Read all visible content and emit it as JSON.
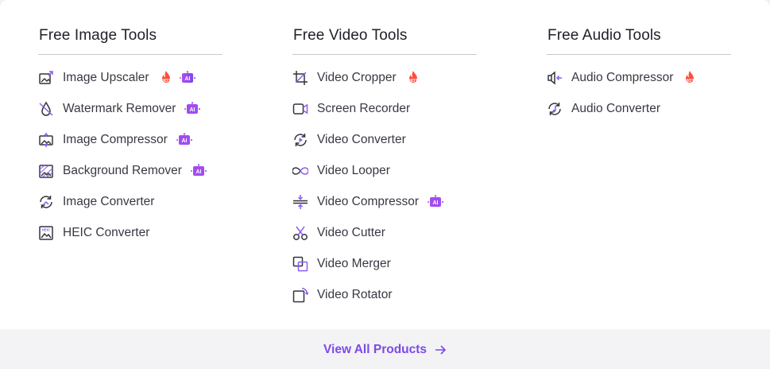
{
  "colors": {
    "accent": "#7d49ea",
    "hot": "#ff4d3a",
    "ai_gradient": [
      "#b14cf2",
      "#7d49ea"
    ],
    "icon_dark": "#34343c",
    "icon_accent": "#8a5cf0"
  },
  "columns": [
    {
      "title": "Free Image Tools",
      "items": [
        {
          "label": "Image Upscaler",
          "icon": "image-upscale-icon",
          "hot": true,
          "ai": true
        },
        {
          "label": "Watermark Remover",
          "icon": "watermark-drop-icon",
          "hot": false,
          "ai": true
        },
        {
          "label": "Image Compressor",
          "icon": "image-compress-icon",
          "hot": false,
          "ai": true
        },
        {
          "label": "Background Remover",
          "icon": "background-remove-icon",
          "hot": false,
          "ai": true
        },
        {
          "label": "Image Converter",
          "icon": "image-convert-icon",
          "hot": false,
          "ai": false
        },
        {
          "label": "HEIC Converter",
          "icon": "heic-icon",
          "hot": false,
          "ai": false
        }
      ]
    },
    {
      "title": "Free Video Tools",
      "items": [
        {
          "label": "Video Cropper",
          "icon": "crop-icon",
          "hot": true,
          "ai": false
        },
        {
          "label": "Screen Recorder",
          "icon": "camera-icon",
          "hot": false,
          "ai": false
        },
        {
          "label": "Video Converter",
          "icon": "video-convert-icon",
          "hot": false,
          "ai": false
        },
        {
          "label": "Video Looper",
          "icon": "infinity-icon",
          "hot": false,
          "ai": false
        },
        {
          "label": "Video Compressor",
          "icon": "compress-icon",
          "hot": false,
          "ai": true
        },
        {
          "label": "Video Cutter",
          "icon": "scissors-icon",
          "hot": false,
          "ai": false
        },
        {
          "label": "Video Merger",
          "icon": "merge-icon",
          "hot": false,
          "ai": false
        },
        {
          "label": "Video Rotator",
          "icon": "rotate-icon",
          "hot": false,
          "ai": false
        }
      ]
    },
    {
      "title": "Free Audio Tools",
      "items": [
        {
          "label": "Audio Compressor",
          "icon": "speaker-compress-icon",
          "hot": true,
          "ai": false
        },
        {
          "label": "Audio Converter",
          "icon": "audio-convert-icon",
          "hot": false,
          "ai": false
        }
      ]
    }
  ],
  "footer": {
    "view_all_label": "View All Products",
    "arrow_icon": "arrow-right-icon"
  }
}
